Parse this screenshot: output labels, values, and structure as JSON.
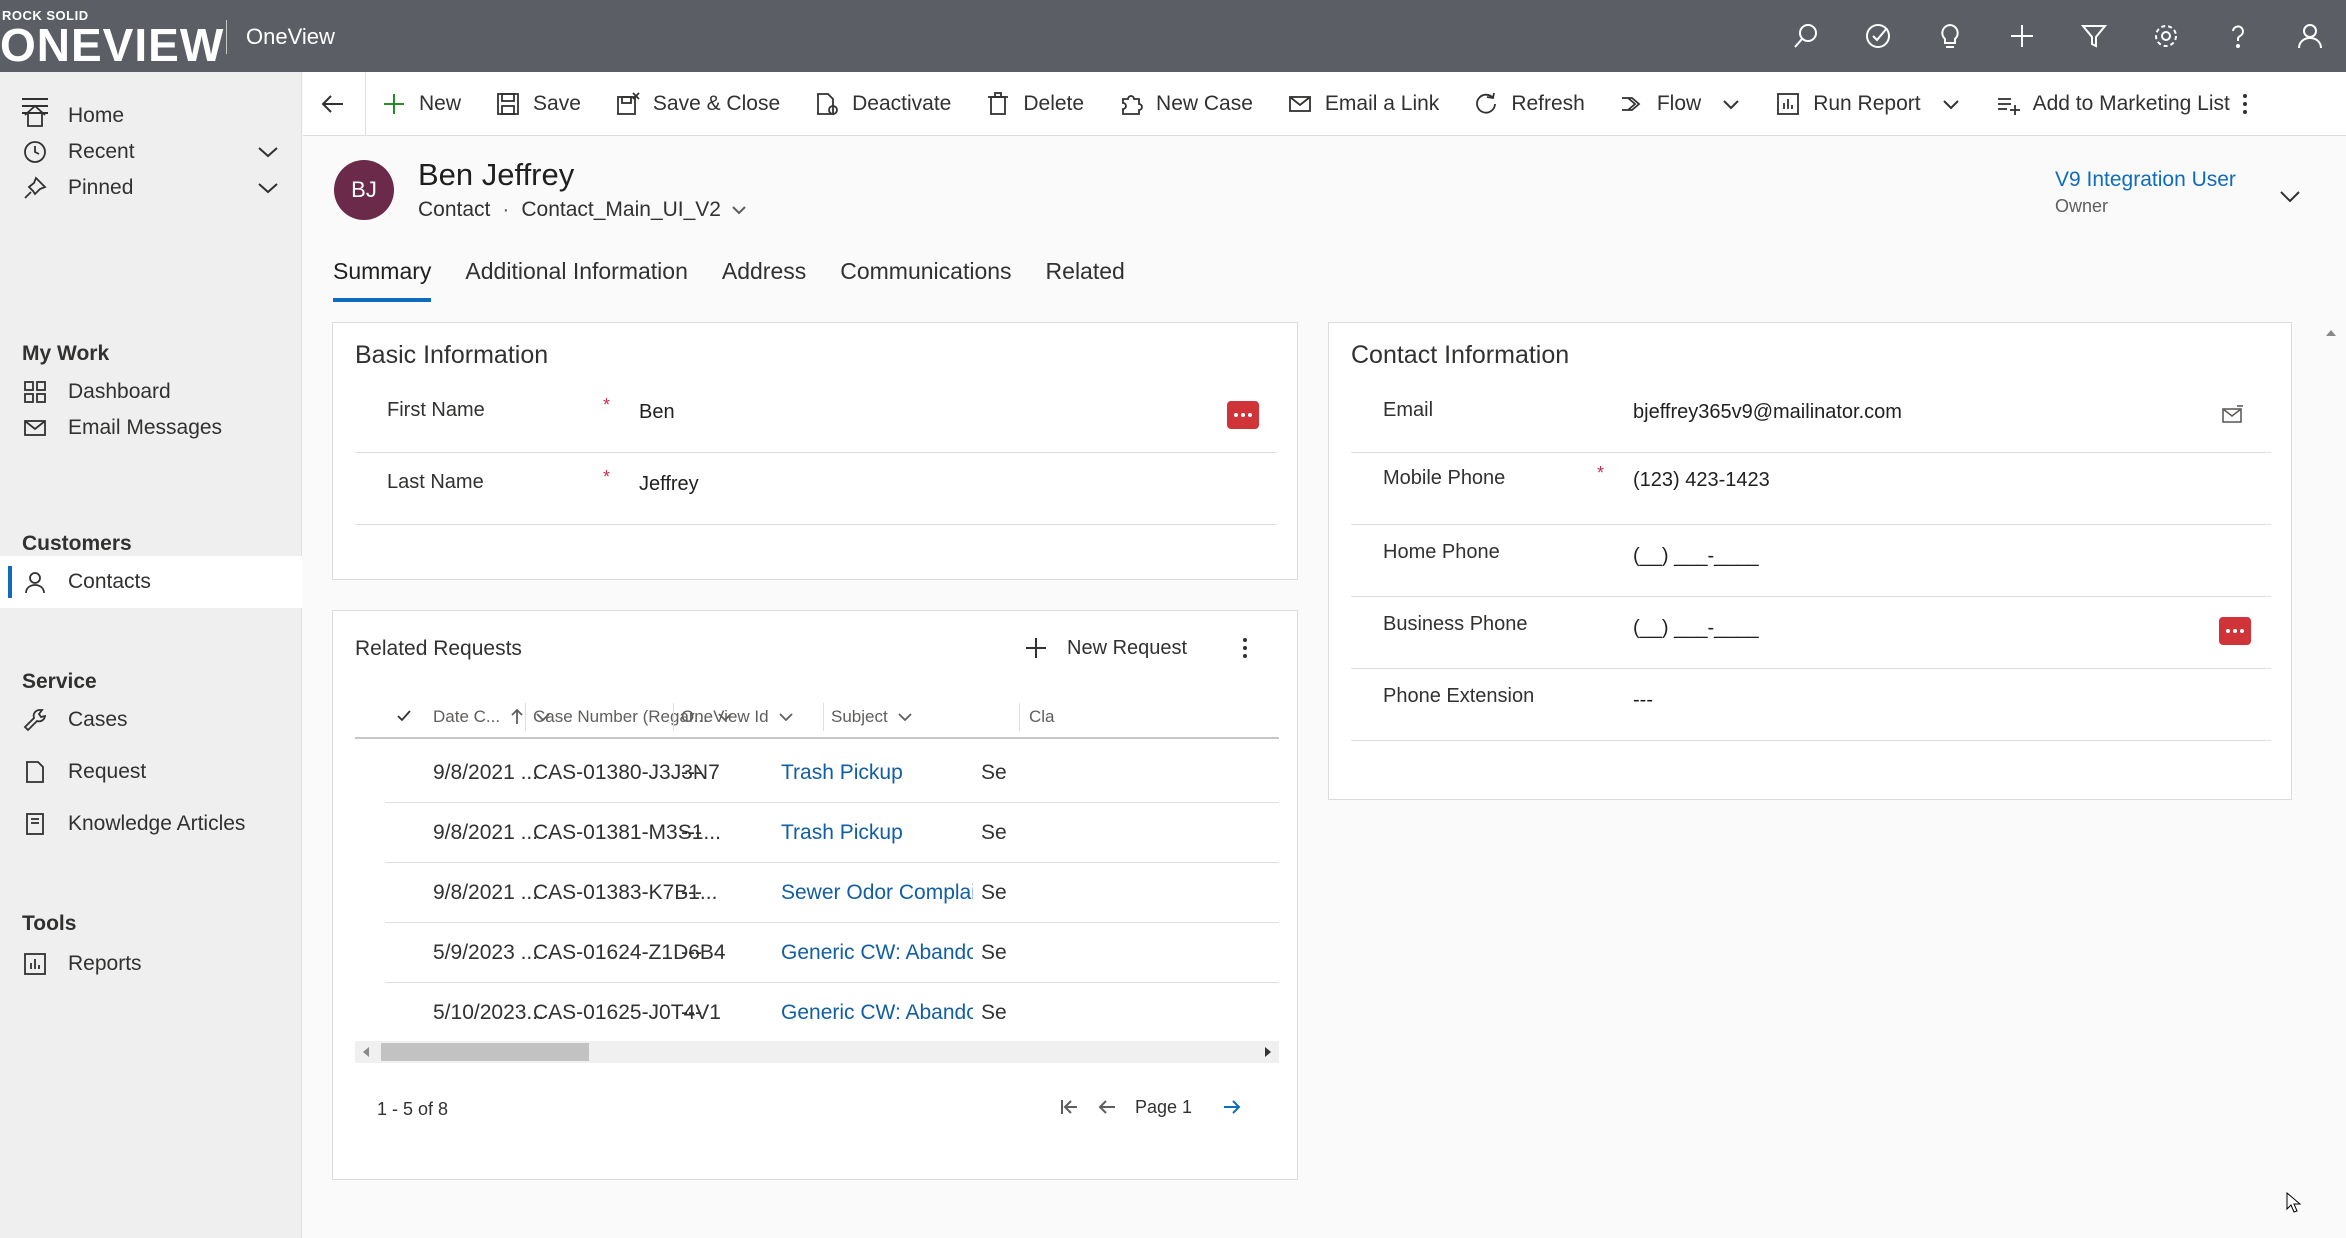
{
  "header": {
    "logo_top": "ROCK SOLID",
    "logo_main": "ONEVIEW",
    "app_name": "OneView",
    "icons": [
      "search-icon",
      "task-icon",
      "lightbulb-icon",
      "plus-icon",
      "filter-icon",
      "settings-icon",
      "help-icon",
      "user-icon"
    ]
  },
  "sidebar": {
    "home": "Home",
    "recent": "Recent",
    "pinned": "Pinned",
    "group_mywork": "My Work",
    "dashboard": "Dashboard",
    "email_messages": "Email Messages",
    "group_customers": "Customers",
    "contacts": "Contacts",
    "group_service": "Service",
    "cases": "Cases",
    "request": "Request",
    "knowledge_articles": "Knowledge Articles",
    "group_tools": "Tools",
    "reports": "Reports"
  },
  "commands": {
    "new": "New",
    "save": "Save",
    "save_close": "Save & Close",
    "deactivate": "Deactivate",
    "delete": "Delete",
    "new_case": "New Case",
    "email_link": "Email a Link",
    "refresh": "Refresh",
    "flow": "Flow",
    "run_report": "Run Report",
    "add_marketing": "Add to Marketing List"
  },
  "record": {
    "initials": "BJ",
    "name": "Ben Jeffrey",
    "entity": "Contact",
    "form": "Contact_Main_UI_V2",
    "owner_name": "V9 Integration User",
    "owner_label": "Owner"
  },
  "tabs": [
    "Summary",
    "Additional Information",
    "Address",
    "Communications",
    "Related"
  ],
  "basic_info": {
    "title": "Basic Information",
    "first_name_label": "First Name",
    "first_name": "Ben",
    "last_name_label": "Last Name",
    "last_name": "Jeffrey"
  },
  "contact_info": {
    "title": "Contact Information",
    "email_label": "Email",
    "email": "bjeffrey365v9@mailinator.com",
    "mobile_label": "Mobile Phone",
    "mobile": "(123) 423-1423",
    "home_label": "Home Phone",
    "home": "(__) ___-____",
    "business_label": "Business Phone",
    "business": "(__) ___-____",
    "ext_label": "Phone Extension",
    "ext": "---"
  },
  "related_requests": {
    "title": "Related Requests",
    "new_request": "New Request",
    "columns": [
      "Date C...",
      "Case Number (Regar...",
      "OneView Id",
      "Subject",
      "Cla"
    ],
    "rows": [
      {
        "date": "9/8/2021 ...",
        "case": "CAS-01380-J3J3N7",
        "id": "---",
        "subject": "Trash Pickup",
        "cla": "Se"
      },
      {
        "date": "9/8/2021 ...",
        "case": "CAS-01381-M3S1...",
        "id": "---",
        "subject": "Trash Pickup",
        "cla": "Se"
      },
      {
        "date": "9/8/2021 ...",
        "case": "CAS-01383-K7B1...",
        "id": "---",
        "subject": "Sewer Odor Complaint",
        "cla": "Se"
      },
      {
        "date": "5/9/2023 ...",
        "case": "CAS-01624-Z1D6B4",
        "id": "---",
        "subject": "Generic CW: Abandoned Vehicl",
        "cla": "Se"
      },
      {
        "date": "5/10/2023...",
        "case": "CAS-01625-J0T4V1",
        "id": "---",
        "subject": "Generic CW: Abandoned Vehicl",
        "cla": "Se"
      }
    ],
    "count": "1 - 5 of 8",
    "page": "Page 1"
  },
  "colors": {
    "header_bg": "#5b5f65",
    "accent": "#0f6cbd",
    "avatar": "#6b2a4a",
    "required": "#c4314b",
    "badge": "#d13438"
  }
}
